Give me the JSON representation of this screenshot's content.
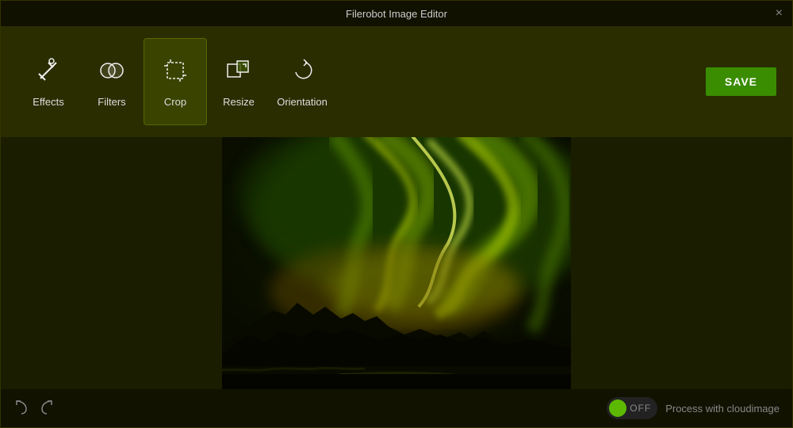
{
  "titlebar": {
    "title": "Filerobot Image Editor",
    "close_label": "×"
  },
  "toolbar": {
    "tools": [
      {
        "id": "effects",
        "label": "Effects",
        "active": false
      },
      {
        "id": "filters",
        "label": "Filters",
        "active": false
      },
      {
        "id": "crop",
        "label": "Crop",
        "active": true
      },
      {
        "id": "resize",
        "label": "Resize",
        "active": false
      },
      {
        "id": "orientation",
        "label": "Orientation",
        "active": false
      }
    ],
    "save_label": "SAVE"
  },
  "bottombar": {
    "undo_title": "Undo",
    "redo_title": "Redo",
    "toggle_state": "OFF",
    "cloudimage_label": "Process with cloudimage"
  }
}
